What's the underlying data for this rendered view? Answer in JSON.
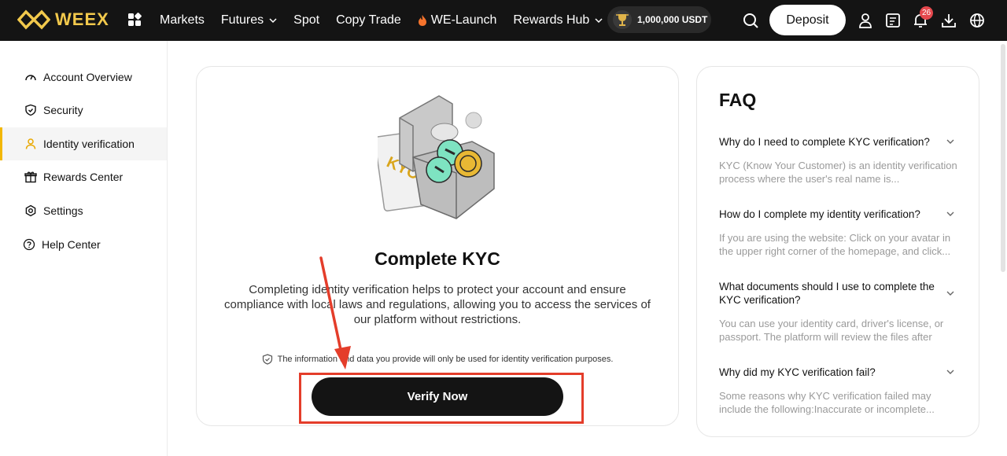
{
  "brand": {
    "name": "WEEX",
    "color": "#f2c94c"
  },
  "nav": {
    "items": [
      {
        "label": "Markets",
        "dropdown": false
      },
      {
        "label": "Futures",
        "dropdown": true
      },
      {
        "label": "Spot",
        "dropdown": false
      },
      {
        "label": "Copy Trade",
        "dropdown": false
      },
      {
        "label": "WE-Launch",
        "dropdown": false,
        "icon": "fire-icon"
      },
      {
        "label": "Rewards Hub",
        "dropdown": true
      }
    ],
    "promo": "1,000,000 USDT",
    "deposit_label": "Deposit",
    "notification_count": "26"
  },
  "sidebar": {
    "items": [
      {
        "label": "Account Overview",
        "icon": "gauge-icon",
        "active": false
      },
      {
        "label": "Security",
        "icon": "shield-icon",
        "active": false
      },
      {
        "label": "Identity verification",
        "icon": "user-icon",
        "active": true
      },
      {
        "label": "Rewards Center",
        "icon": "gift-icon",
        "active": false
      },
      {
        "label": "Settings",
        "icon": "gear-icon",
        "active": false
      },
      {
        "label": "Help Center",
        "icon": "help-icon",
        "active": false
      }
    ]
  },
  "kyc": {
    "art_label": "KYC",
    "title": "Complete KYC",
    "description": "Completing identity verification helps to protect your account and ensure compliance with local laws and regulations, allowing you to access the services of our platform without restrictions.",
    "notice": "The information and data you provide will only be used for identity verification purposes.",
    "button_label": "Verify Now"
  },
  "faq": {
    "title": "FAQ",
    "items": [
      {
        "question": "Why do I need to complete KYC verification?",
        "answer": "KYC (Know Your Customer) is an identity verification process where the user's real name is..."
      },
      {
        "question": "How do I complete my identity verification?",
        "answer": "If you are using the website: Click on your avatar in the upper right corner of the homepage, and click..."
      },
      {
        "question": "What documents should I use to complete the KYC verification?",
        "answer": "You can use your identity card, driver's license, or passport. The platform will review the files after you..."
      },
      {
        "question": "Why did my KYC verification fail?",
        "answer": "Some reasons why KYC verification failed may include the following:Inaccurate or incomplete..."
      }
    ]
  },
  "annotation": {
    "color": "#e43d2a"
  }
}
